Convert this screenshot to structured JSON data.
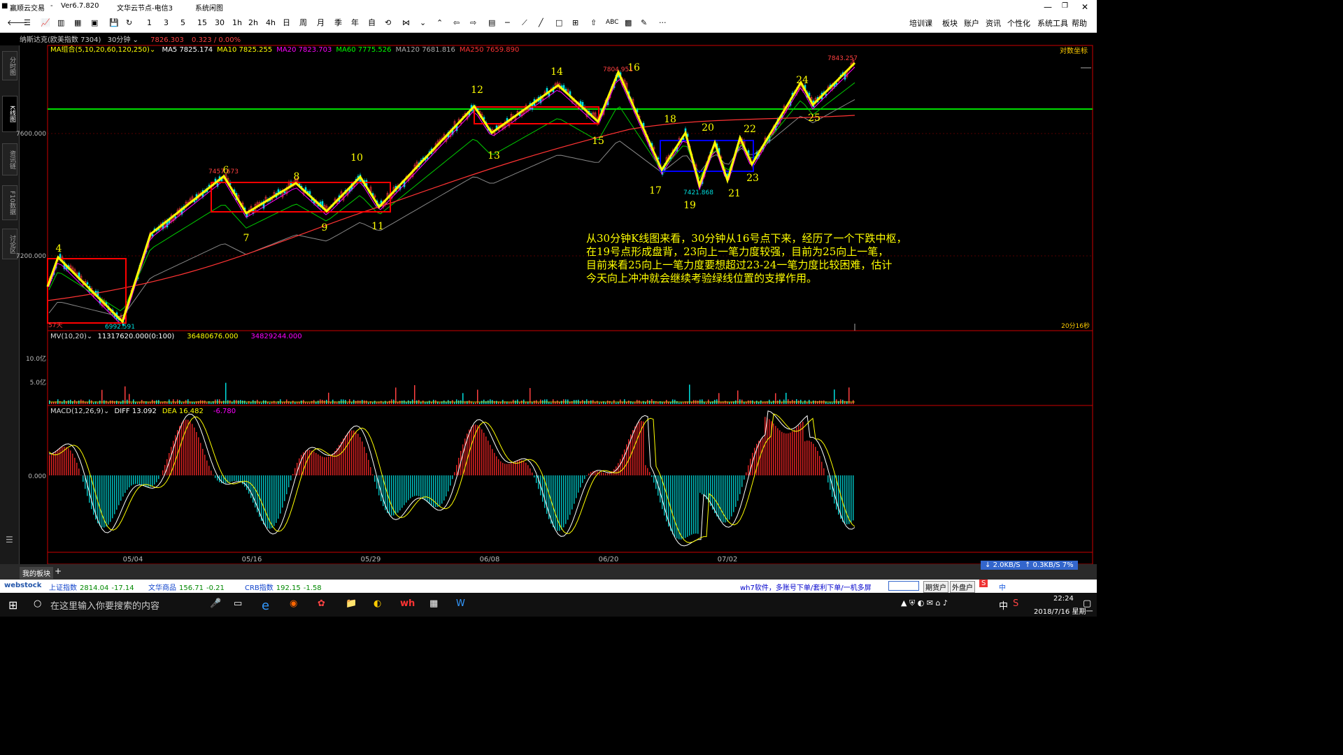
{
  "window": {
    "app_title": "赢顺云交易",
    "version": "Ver6.7.820",
    "server": "文华云节点-电信3",
    "menu_label": "系统闲图"
  },
  "toolbar": {
    "periods": [
      "1",
      "3",
      "5",
      "15",
      "30",
      "1h",
      "2h",
      "4h",
      "日",
      "周",
      "月",
      "季",
      "年",
      "自"
    ],
    "right_menu": [
      "培训课",
      "板块",
      "账户",
      "资讯",
      "个性化",
      "系统工具",
      "帮助"
    ]
  },
  "instrument": {
    "name": "纳斯达克(欧美指数 7304)",
    "period": "30分钟",
    "price": "7826.303",
    "change": "0.323 / 0.00%"
  },
  "ma_legend": {
    "name": "MA组合(5,10,20,60,120,250)",
    "items": [
      {
        "label": "MA5 7825.174",
        "color": "#ffffff"
      },
      {
        "label": "MA10 7825.255",
        "color": "#ffff00"
      },
      {
        "label": "MA20 7823.703",
        "color": "#ff00ff"
      },
      {
        "label": "MA60 7775.526",
        "color": "#00ff00"
      },
      {
        "label": "MA120 7681.816",
        "color": "#aaaaaa"
      },
      {
        "label": "MA250 7659.890",
        "color": "#ff3333"
      }
    ]
  },
  "log_label": "对数坐标",
  "price_axis": [
    "7600.000",
    "7200.000"
  ],
  "price_labels": {
    "high": "7843.257",
    "peak16": "7804.951",
    "low": "6992.591",
    "low19": "7421.868",
    "high6": "7457.673",
    "bars": "57天"
  },
  "timer": "20分16秒",
  "points": [
    "4",
    "6",
    "7",
    "8",
    "9",
    "10",
    "11",
    "12",
    "13",
    "14",
    "15",
    "16",
    "17",
    "18",
    "19",
    "20",
    "21",
    "22",
    "23",
    "24",
    "25"
  ],
  "commentary": [
    "从30分钟K线图来看，30分钟从16号点下来，经历了一个下跌中枢，",
    "在19号点形成盘背，23向上一笔力度较强，目前为25向上一笔，",
    "目前来看25向上一笔力度要想超过23-24一笔力度比较困难，估计",
    "今天向上冲冲就会继续考验绿线位置的支撑作用。"
  ],
  "volume": {
    "legend": "MV(10,20)",
    "v1": "11317620.000(0:100)",
    "v2": "36480676.000",
    "v3": "34829244.000",
    "axis": [
      "10.0亿",
      "5.0亿"
    ]
  },
  "macd": {
    "legend": "MACD(12,26,9)",
    "diff": "DIFF 13.092",
    "dea": "DEA 16.482",
    "macd": "-6.780",
    "axis": "0.000"
  },
  "dates": [
    "05/04",
    "05/16",
    "05/29",
    "06/08",
    "06/20",
    "07/02"
  ],
  "left_tabs": [
    "分时图",
    "K线图",
    "资讯链",
    "F10数据",
    "讨论区"
  ],
  "bottom": {
    "tab": "我的板块",
    "speed_down": "2.0KB/S",
    "speed_up": "0.3KB/S",
    "pct": "7%"
  },
  "tickers": [
    {
      "name": "上证指数",
      "val": "2814.04",
      "chg": "-17.14"
    },
    {
      "name": "文华商品",
      "val": "156.71",
      "chg": "-0.21"
    },
    {
      "name": "CRB指数",
      "val": "192.15",
      "chg": "-1.58"
    }
  ],
  "promo": "wh7软件，多账号下单/套利下单/一机多屏",
  "ticker_buttons": [
    "期货户",
    "外盘户"
  ],
  "taskbar": {
    "search": "在这里输入你要搜索的内容",
    "time": "22:24",
    "date": "2018/7/16 星期一",
    "ime": "中"
  },
  "colors": {
    "k_up": "#ff4040",
    "k_down": "#00e0e0",
    "stroke": "#ffff00",
    "green_line": "#00dd00"
  }
}
